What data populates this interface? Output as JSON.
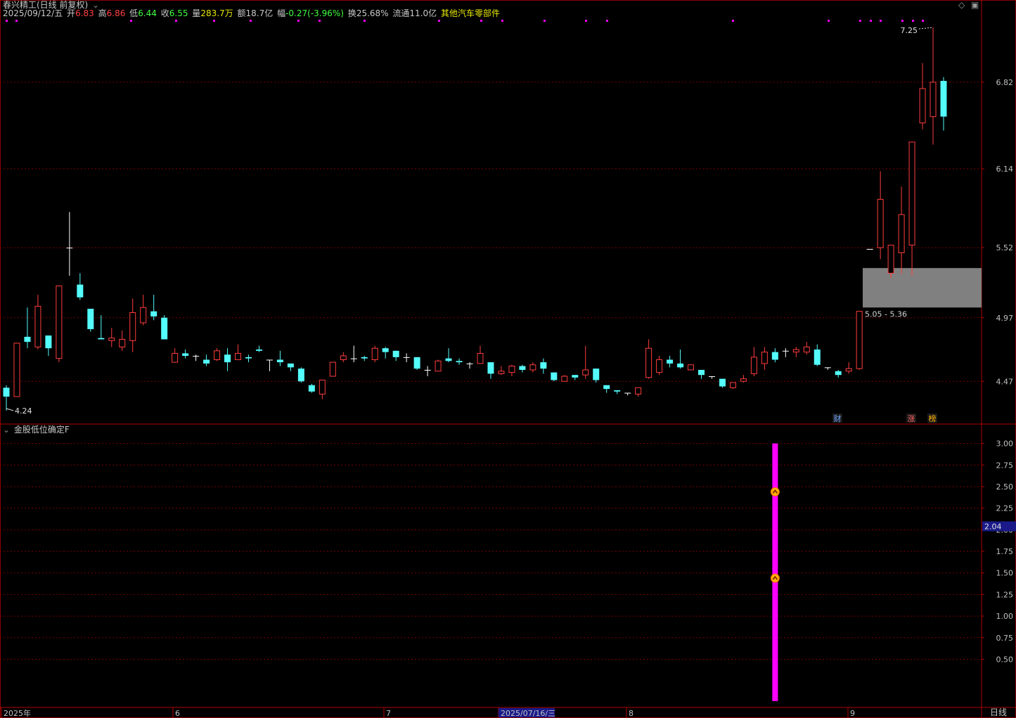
{
  "header": {
    "title": "春兴精工(日线 前复权)",
    "date": "2025/09/12/五",
    "open_label": "开",
    "open": "6.83",
    "high_label": "高",
    "high": "6.86",
    "low_label": "低",
    "low": "6.44",
    "close_label": "收",
    "close": "6.55",
    "vol_label": "量",
    "volume": "283.7万",
    "amount_label": "额",
    "amount": "18.7亿",
    "change_label": "幅",
    "change": "-0.27(-3.96%)",
    "turnover_label": "换",
    "turnover": "25.68%",
    "float_label": "流通",
    "float": "11.0亿",
    "sector": "其他汽车零部件"
  },
  "indicator": {
    "name": "金股低位确定F",
    "current_value": "2.04"
  },
  "annotations": {
    "low": "4.24",
    "high": "7.25",
    "zone": "5.05 - 5.36",
    "markers": [
      "财",
      "涨",
      "榜"
    ]
  },
  "period_label": "日线",
  "colors": {
    "up": "#ff3c3c",
    "down": "#54fcfc",
    "doji": "#ffffff",
    "grid": "#7a0000",
    "signal": "#ff00ff",
    "zone": "#808080",
    "axis_text": "#c0c0c0"
  },
  "chart_data": [
    {
      "type": "candlestick",
      "y_ticks": [
        4.47,
        4.97,
        5.52,
        6.14,
        6.82
      ],
      "x_labels": [
        "2025年",
        "6",
        "7",
        "2025/07/16/三",
        "8",
        "9"
      ],
      "candles": [
        [
          4.42,
          4.35,
          4.44,
          4.24
        ],
        [
          4.35,
          4.77,
          4.77,
          4.35
        ],
        [
          4.82,
          4.78,
          5.05,
          4.73
        ],
        [
          4.74,
          5.06,
          5.15,
          4.72
        ],
        [
          4.83,
          4.73,
          4.83,
          4.67
        ],
        [
          4.65,
          5.22,
          5.22,
          4.62
        ],
        [
          5.52,
          5.52,
          5.8,
          5.3
        ],
        [
          5.23,
          5.13,
          5.32,
          5.11
        ],
        [
          5.04,
          4.88,
          5.04,
          4.86
        ],
        [
          4.81,
          4.8,
          4.99,
          4.8
        ],
        [
          4.79,
          4.81,
          4.89,
          4.74
        ],
        [
          4.74,
          4.8,
          4.87,
          4.71
        ],
        [
          4.79,
          5.01,
          5.12,
          4.7
        ],
        [
          4.93,
          5.05,
          5.15,
          4.91
        ],
        [
          5.02,
          4.98,
          5.15,
          4.95
        ],
        [
          4.97,
          4.8,
          4.99,
          4.8
        ],
        [
          4.62,
          4.69,
          4.73,
          4.62
        ],
        [
          4.69,
          4.67,
          4.72,
          4.65
        ],
        [
          4.67,
          4.67,
          4.68,
          4.63
        ],
        [
          4.64,
          4.61,
          4.68,
          4.59
        ],
        [
          4.64,
          4.71,
          4.73,
          4.63
        ],
        [
          4.68,
          4.62,
          4.73,
          4.55
        ],
        [
          4.64,
          4.69,
          4.76,
          4.64
        ],
        [
          4.66,
          4.65,
          4.68,
          4.62
        ],
        [
          4.72,
          4.71,
          4.75,
          4.7
        ],
        [
          4.64,
          4.64,
          4.64,
          4.55
        ],
        [
          4.64,
          4.62,
          4.71,
          4.59
        ],
        [
          4.61,
          4.58,
          4.61,
          4.55
        ],
        [
          4.57,
          4.47,
          4.58,
          4.46
        ],
        [
          4.44,
          4.39,
          4.45,
          4.38
        ],
        [
          4.37,
          4.48,
          4.48,
          4.33
        ],
        [
          4.51,
          4.62,
          4.62,
          4.51
        ],
        [
          4.64,
          4.67,
          4.7,
          4.62
        ],
        [
          4.65,
          4.65,
          4.75,
          4.62
        ],
        [
          4.66,
          4.65,
          4.67,
          4.63
        ],
        [
          4.64,
          4.73,
          4.75,
          4.62
        ],
        [
          4.73,
          4.7,
          4.74,
          4.65
        ],
        [
          4.71,
          4.66,
          4.71,
          4.63
        ],
        [
          4.66,
          4.66,
          4.69,
          4.62
        ],
        [
          4.66,
          4.57,
          4.66,
          4.56
        ],
        [
          4.56,
          4.56,
          4.59,
          4.51
        ],
        [
          4.55,
          4.63,
          4.64,
          4.55
        ],
        [
          4.65,
          4.63,
          4.73,
          4.62
        ],
        [
          4.63,
          4.62,
          4.65,
          4.6
        ],
        [
          4.61,
          4.61,
          4.62,
          4.57
        ],
        [
          4.61,
          4.69,
          4.75,
          4.61
        ],
        [
          4.62,
          4.53,
          4.62,
          4.49
        ],
        [
          4.53,
          4.55,
          4.59,
          4.52
        ],
        [
          4.54,
          4.59,
          4.6,
          4.51
        ],
        [
          4.59,
          4.56,
          4.6,
          4.54
        ],
        [
          4.56,
          4.6,
          4.62,
          4.54
        ],
        [
          4.62,
          4.57,
          4.65,
          4.53
        ],
        [
          4.54,
          4.48,
          4.54,
          4.47
        ],
        [
          4.47,
          4.51,
          4.52,
          4.47
        ],
        [
          4.52,
          4.5,
          4.52,
          4.48
        ],
        [
          4.52,
          4.56,
          4.75,
          4.49
        ],
        [
          4.57,
          4.48,
          4.57,
          4.46
        ],
        [
          4.44,
          4.41,
          4.44,
          4.38
        ],
        [
          4.4,
          4.39,
          4.4,
          4.37
        ],
        [
          4.38,
          4.38,
          4.38,
          4.36
        ],
        [
          4.37,
          4.42,
          4.42,
          4.35
        ],
        [
          4.5,
          4.73,
          4.8,
          4.49
        ],
        [
          4.54,
          4.64,
          4.67,
          4.52
        ],
        [
          4.64,
          4.61,
          4.67,
          4.58
        ],
        [
          4.61,
          4.58,
          4.72,
          4.57
        ],
        [
          4.56,
          4.6,
          4.6,
          4.56
        ],
        [
          4.56,
          4.52,
          4.56,
          4.49
        ],
        [
          4.51,
          4.51,
          4.51,
          4.49
        ],
        [
          4.49,
          4.43,
          4.49,
          4.42
        ],
        [
          4.42,
          4.46,
          4.46,
          4.41
        ],
        [
          4.47,
          4.49,
          4.52,
          4.46
        ],
        [
          4.53,
          4.66,
          4.74,
          4.51
        ],
        [
          4.61,
          4.7,
          4.74,
          4.56
        ],
        [
          4.7,
          4.64,
          4.73,
          4.62
        ],
        [
          4.71,
          4.71,
          4.73,
          4.66
        ],
        [
          4.7,
          4.72,
          4.74,
          4.66
        ],
        [
          4.7,
          4.74,
          4.78,
          4.68
        ],
        [
          4.72,
          4.6,
          4.76,
          4.59
        ],
        [
          4.58,
          4.58,
          4.58,
          4.56
        ],
        [
          4.55,
          4.52,
          4.56,
          4.5
        ],
        [
          4.55,
          4.57,
          4.62,
          4.53
        ],
        [
          4.57,
          5.02,
          5.02,
          4.56
        ],
        [
          5.51,
          5.51,
          5.51,
          5.51
        ],
        [
          5.52,
          5.9,
          6.12,
          5.43
        ],
        [
          5.32,
          5.54,
          5.54,
          5.28
        ],
        [
          5.48,
          5.78,
          6.0,
          5.31
        ],
        [
          5.54,
          6.35,
          6.35,
          5.3
        ],
        [
          6.5,
          6.77,
          6.97,
          6.45
        ],
        [
          6.55,
          6.82,
          7.25,
          6.33
        ],
        [
          6.83,
          6.55,
          6.86,
          6.44
        ]
      ],
      "y_range": [
        4.14,
        7.3
      ]
    },
    {
      "type": "bar",
      "series": [
        {
          "values": [
            3.0
          ]
        }
      ],
      "signal_index": 73,
      "markers": [
        2.44,
        1.44
      ],
      "y_ticks": [
        0.5,
        0.75,
        1.0,
        1.25,
        1.5,
        1.75,
        2.0,
        2.25,
        2.5,
        2.75,
        3.0
      ],
      "y_range": [
        -0.05,
        3.07
      ]
    }
  ]
}
